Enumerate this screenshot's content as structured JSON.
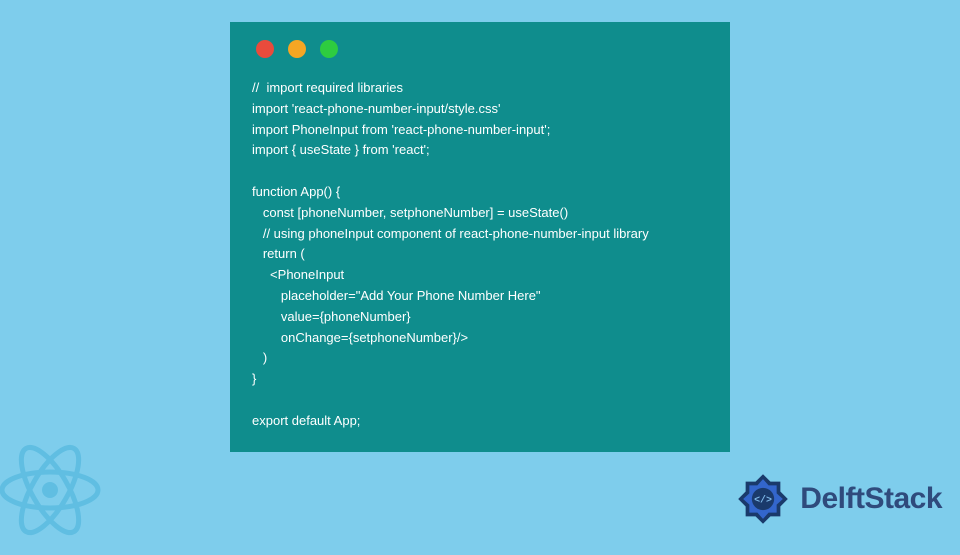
{
  "window": {
    "dots": [
      "red",
      "yellow",
      "green"
    ]
  },
  "code": {
    "lines": [
      "//  import required libraries",
      "import 'react-phone-number-input/style.css'",
      "import PhoneInput from 'react-phone-number-input';",
      "import { useState } from 'react';",
      "",
      "function App() {",
      "   const [phoneNumber, setphoneNumber] = useState()",
      "   // using phoneInput component of react-phone-number-input library",
      "   return (",
      "     <PhoneInput",
      "        placeholder=\"Add Your Phone Number Here\"",
      "        value={phoneNumber}",
      "        onChange={setphoneNumber}/>",
      "   )",
      "}",
      "",
      "export default App;"
    ]
  },
  "brand": {
    "name": "DelftStack"
  },
  "colors": {
    "bg": "#7ecdec",
    "window": "#0f8d8d",
    "text": "#ffffff",
    "brand": "#2f4b7c"
  }
}
